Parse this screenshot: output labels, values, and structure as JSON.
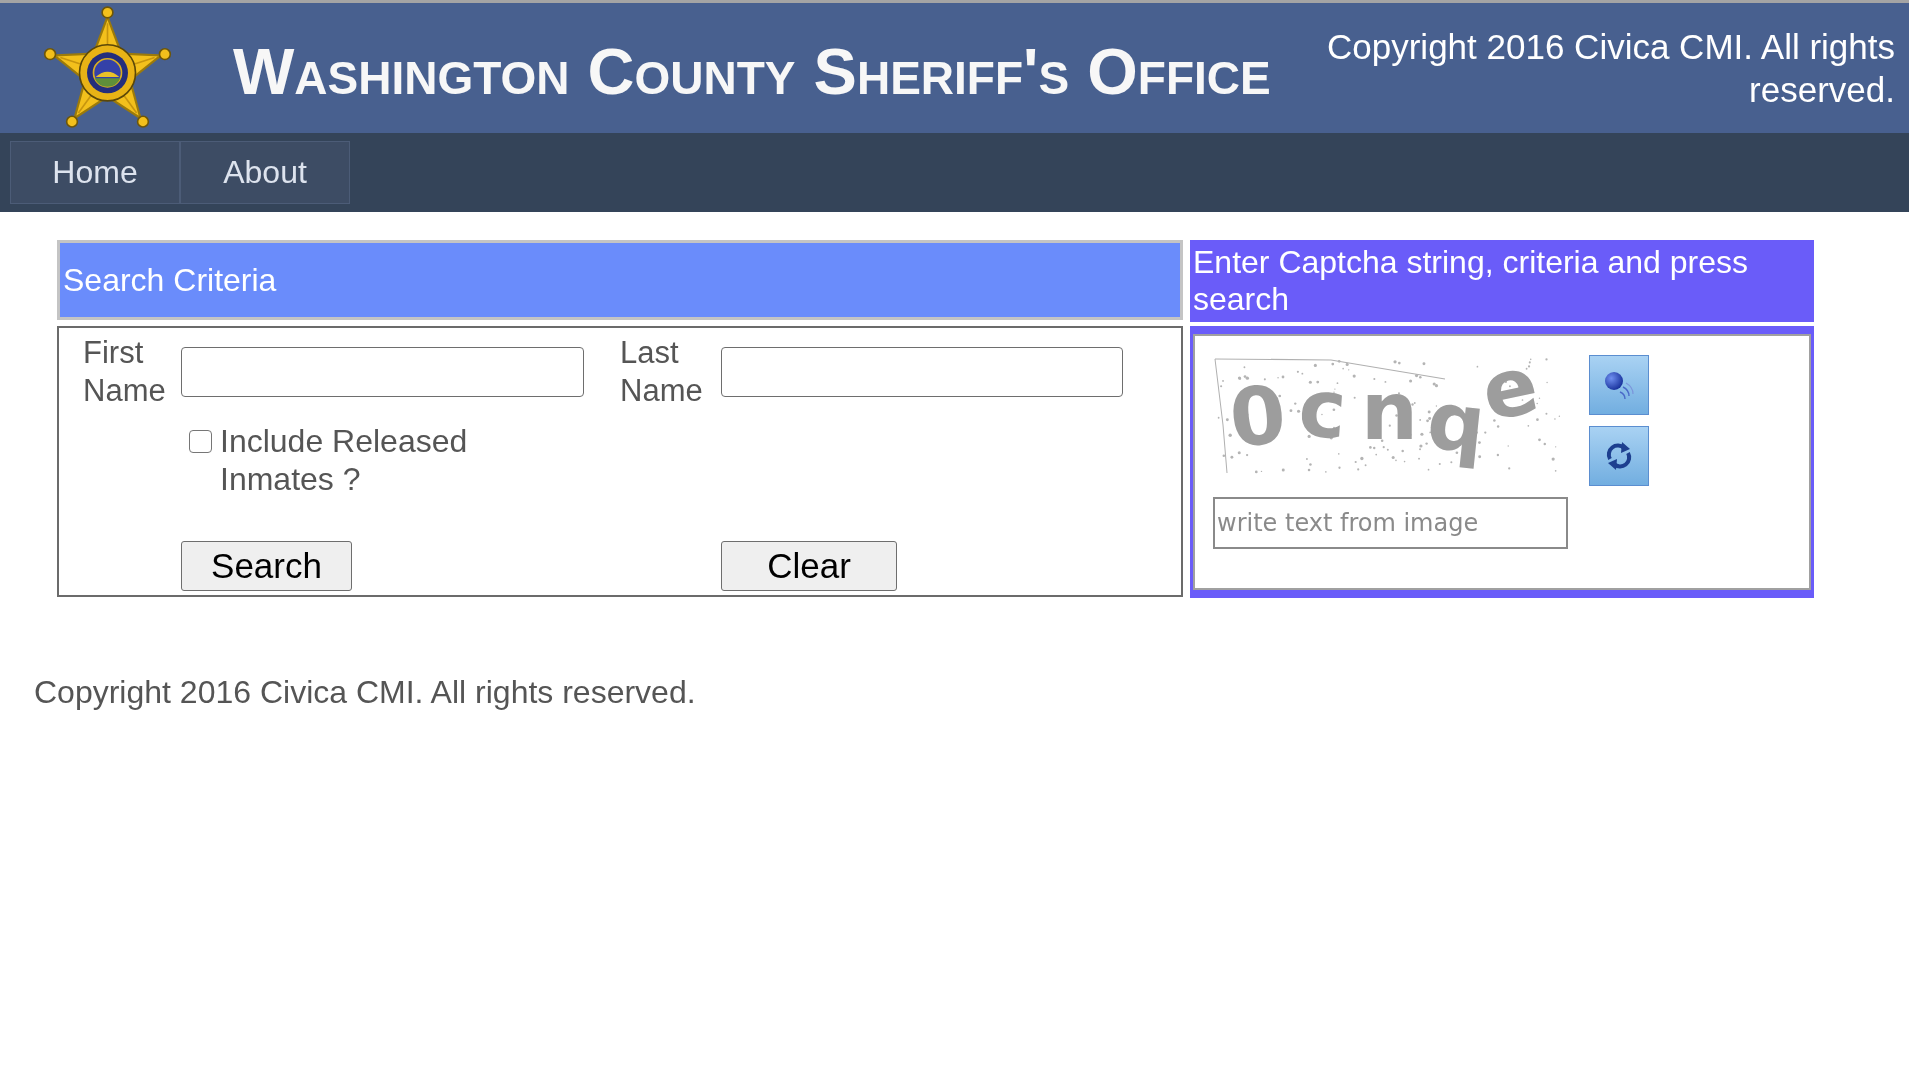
{
  "header": {
    "title": "Washington County Sheriff's Office",
    "copyright": "Copyright 2016 Civica CMI. All rights reserved."
  },
  "nav": [
    {
      "label": "Home"
    },
    {
      "label": "About"
    }
  ],
  "search_panel": {
    "title": "Search Criteria",
    "fields": [
      {
        "label": "First Name"
      },
      {
        "label": "Last Name"
      }
    ],
    "include_released": {
      "label": "Include Released Inmates ?",
      "checked": false
    },
    "buttons": [
      "Search",
      "Clear"
    ]
  },
  "captcha_panel": {
    "title": "Enter Captcha string, criteria and press search",
    "captcha_text": "0cnqe",
    "input": {
      "placeholder": "write text from image"
    }
  },
  "footer": {
    "copyright": "Copyright 2016 Civica CMI. All rights reserved."
  }
}
